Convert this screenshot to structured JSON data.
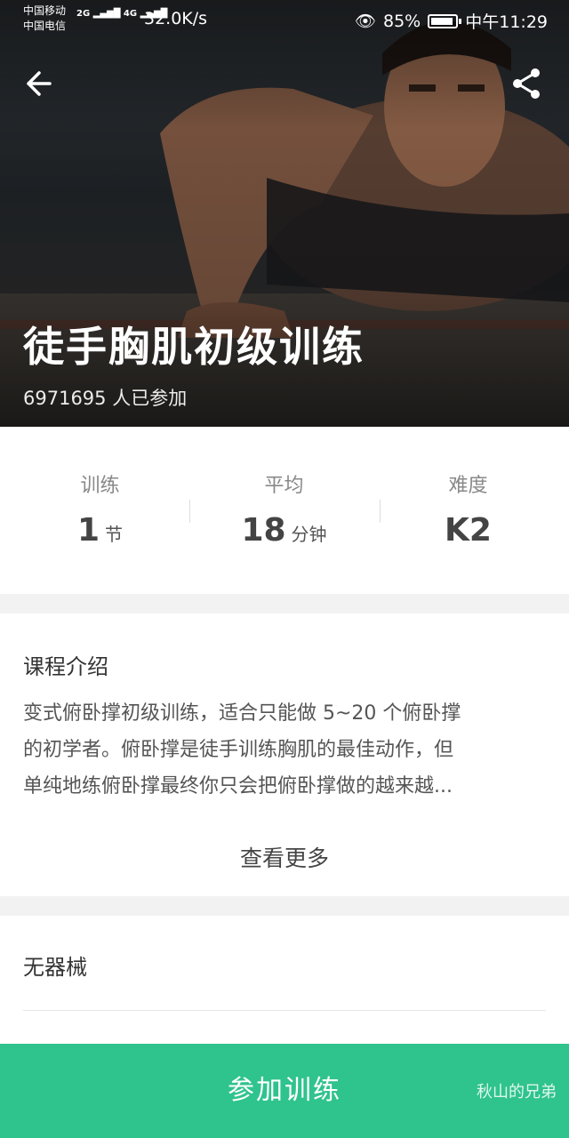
{
  "status_bar": {
    "carrier1": "中国移动",
    "carrier2": "中国电信",
    "net1": "2G",
    "net2": "4G",
    "speed": "32.0K/s",
    "battery": "85%",
    "time": "中午11:29"
  },
  "hero": {
    "title": "徒手胸肌初级训练",
    "participants": "6971695 人已参加"
  },
  "stats": [
    {
      "label": "训练",
      "value": "1",
      "unit": "节"
    },
    {
      "label": "平均",
      "value": "18",
      "unit": "分钟"
    },
    {
      "label": "难度",
      "value": "K2",
      "unit": ""
    }
  ],
  "intro": {
    "title": "课程介绍",
    "lines": [
      "变式俯卧撑初级训练，适合只能做 5~20 个俯卧撑",
      "的初学者。俯卧撑是徒手训练胸肌的最佳动作，但",
      "单纯地练俯卧撑最终你只会把俯卧撑做的越来越..."
    ],
    "more": "查看更多"
  },
  "equipment": {
    "label": "无器械"
  },
  "join_button": "参加训练",
  "watermark": "秋山的兄弟",
  "colors": {
    "accent": "#2fc38d"
  }
}
